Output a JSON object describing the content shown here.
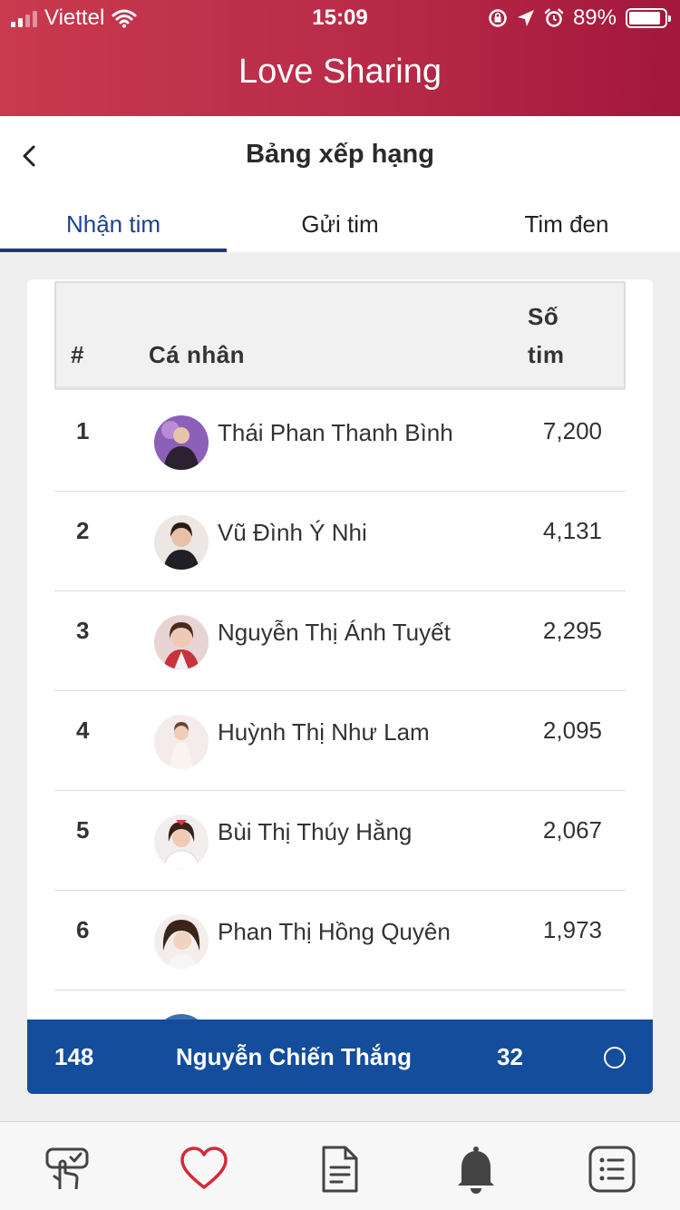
{
  "status_bar": {
    "carrier": "Viettel",
    "time": "15:09",
    "battery": "89%",
    "battery_level": 0.89
  },
  "app": {
    "title": "Love Sharing"
  },
  "page": {
    "title": "Bảng xếp hạng"
  },
  "tabs": [
    {
      "label": "Nhận tim",
      "active": true
    },
    {
      "label": "Gửi tim",
      "active": false
    },
    {
      "label": "Tim đen",
      "active": false
    }
  ],
  "table": {
    "headers": {
      "rank": "#",
      "person": "Cá nhân",
      "score_line1": "Số",
      "score_line2": "tim"
    },
    "rows": [
      {
        "rank": "1",
        "name": "Thái Phan Thanh Bình",
        "score": "7,200"
      },
      {
        "rank": "2",
        "name": "Vũ Đình Ý Nhi",
        "score": "4,131"
      },
      {
        "rank": "3",
        "name": "Nguyễn Thị Ánh Tuyết",
        "score": "2,295"
      },
      {
        "rank": "4",
        "name": "Huỳnh Thị Như Lam",
        "score": "2,095"
      },
      {
        "rank": "5",
        "name": "Bùi Thị Thúy Hằng",
        "score": "2,067"
      },
      {
        "rank": "6",
        "name": "Phan Thị Hồng Quyên",
        "score": "1,973"
      }
    ]
  },
  "current_user": {
    "rank": "148",
    "name": "Nguyễn Chiến Thắng",
    "score": "32"
  },
  "bottom_nav": [
    {
      "icon": "tap-check-icon"
    },
    {
      "icon": "heart-icon",
      "active": true
    },
    {
      "icon": "document-icon"
    },
    {
      "icon": "bell-icon"
    },
    {
      "icon": "list-icon"
    }
  ],
  "colors": {
    "header_start": "#c93a4e",
    "header_end": "#a3173c",
    "accent_blue": "#134d9b",
    "tab_active": "#1f3f8f",
    "heart": "#d42a3c"
  }
}
